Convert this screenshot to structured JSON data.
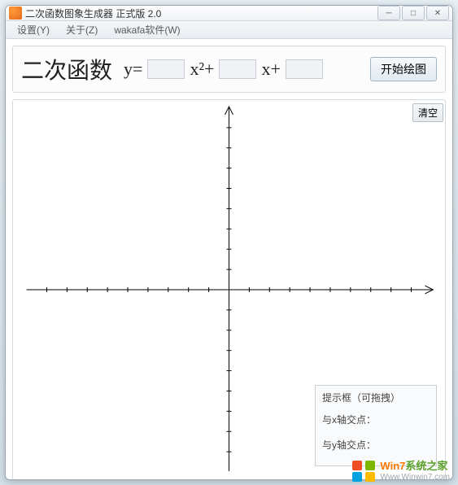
{
  "window": {
    "title": "二次函数图象生成器 正式版 2.0"
  },
  "menu": {
    "settings": "设置(Y)",
    "about": "关于(Z)",
    "wakafa": "wakafa软件(W)"
  },
  "formula": {
    "heading": "二次函数",
    "y_eq": "y=",
    "x2": "x²+",
    "x1": "x+",
    "a": "",
    "b": "",
    "c": "",
    "start_btn": "开始绘图"
  },
  "plot": {
    "clear_btn": "清空"
  },
  "hint": {
    "title": "提示框（可拖拽）",
    "x_intersect_label": "与x轴交点：",
    "y_intersect_label": "与y轴交点：",
    "x_intersect_value": "",
    "y_intersect_value": ""
  },
  "chart_data": {
    "type": "line",
    "series": [],
    "x_axis": {
      "range": [
        -10,
        10
      ],
      "ticks_visible": true
    },
    "y_axis": {
      "range": [
        -10,
        10
      ],
      "ticks_visible": true
    },
    "title": "",
    "xlabel": "",
    "ylabel": "",
    "grid": false
  },
  "watermark": {
    "line1_prefix": "Win7",
    "line1_suffix": "系统之家",
    "line2": "Www.Winwin7.com"
  }
}
